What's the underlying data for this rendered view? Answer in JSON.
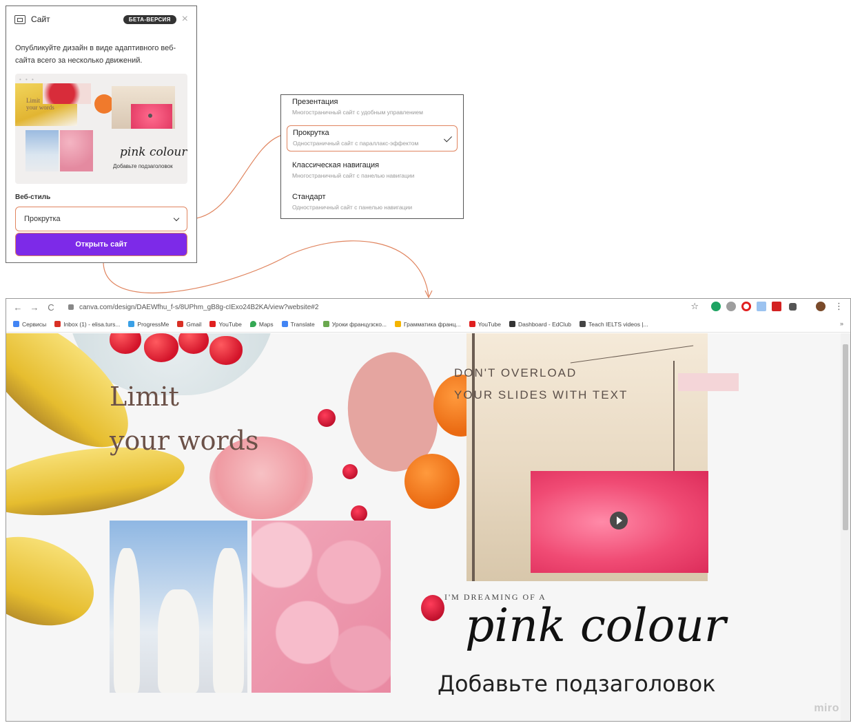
{
  "panel": {
    "title": "Сайт",
    "beta": "БЕТА-ВЕРСИЯ",
    "description": "Опубликуйте дизайн в виде адаптивного веб-сайта всего за несколько движений.",
    "thumb_text_1": "Limit",
    "thumb_text_2": "your words",
    "thumb_pink": "pink colour",
    "thumb_sub": "Добавьте подзаголовок",
    "style_label": "Веб-стиль",
    "style_value": "Прокрутка",
    "open_button": "Открыть сайт"
  },
  "style_options": [
    {
      "title": "Презентация",
      "description": "Многостраничный сайт с удобным управлением",
      "selected": false
    },
    {
      "title": "Прокрутка",
      "description": "Одностраничный сайт с параллакс-эффектом",
      "selected": true
    },
    {
      "title": "Классическая навигация",
      "description": "Многостраничный сайт с панелью навигации",
      "selected": false
    },
    {
      "title": "Стандарт",
      "description": "Одностраничный сайт с панелью навигации",
      "selected": false
    }
  ],
  "browser": {
    "url": "canva.com/design/DAEWfhu_f-s/8UPhm_gB8g-cIExo24B2KA/view?website#2",
    "bookmarks": [
      {
        "label": "Сервисы",
        "color": "#4285f4"
      },
      {
        "label": "Inbox (1) - elisa.turs...",
        "color": "#d93025"
      },
      {
        "label": "ProgressMe",
        "color": "#3aa0e6"
      },
      {
        "label": "Gmail",
        "color": "#d93025"
      },
      {
        "label": "YouTube",
        "color": "#e01f1f"
      },
      {
        "label": "Maps",
        "color": "#34a853"
      },
      {
        "label": "Translate",
        "color": "#4285f4"
      },
      {
        "label": "Уроки французско...",
        "color": "#6aa84f"
      },
      {
        "label": "Грамматика франц...",
        "color": "#f4b400"
      },
      {
        "label": "YouTube",
        "color": "#e01f1f"
      },
      {
        "label": "Dashboard - EdClub",
        "color": "#333333"
      },
      {
        "label": "Teach IELTS videos |...",
        "color": "#444444"
      }
    ],
    "bookmarks_more": "»"
  },
  "page": {
    "limit_line1": "Limit",
    "limit_line2": "your words",
    "dont_line1": "DON'T OVERLOAD",
    "dont_line2": "YOUR SLIDES WITH TEXT",
    "dreaming": "I'M DREAMING OF A",
    "pink_colour": "pink colour",
    "subheading": "Добавьте подзаголовок"
  },
  "watermark": "miro",
  "colors": {
    "accent_purple": "#7d2ae8",
    "highlight_border": "#e0845e"
  }
}
